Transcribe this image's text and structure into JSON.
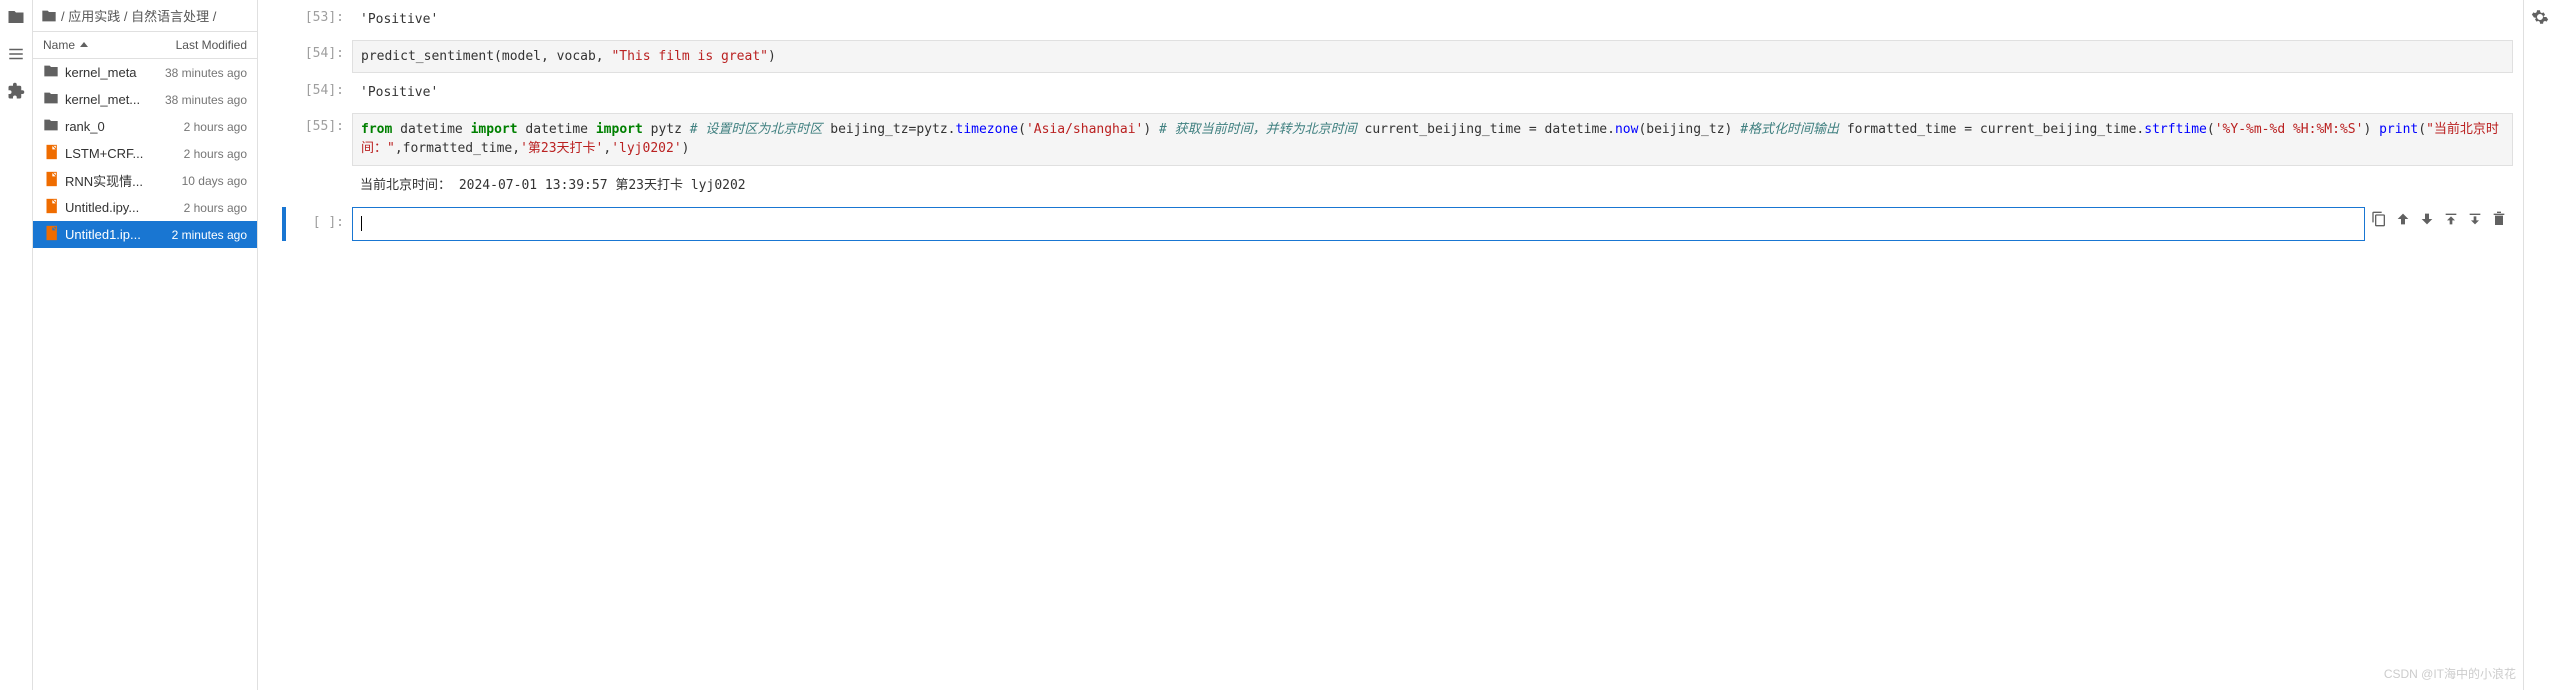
{
  "breadcrumb": {
    "parts": [
      "/",
      "应用实践",
      "/",
      "自然语言处理",
      "/"
    ]
  },
  "file_header": {
    "name": "Name",
    "modified": "Last Modified"
  },
  "files": [
    {
      "name": "kernel_meta",
      "time": "38 minutes ago",
      "type": "folder"
    },
    {
      "name": "kernel_met...",
      "time": "38 minutes ago",
      "type": "folder"
    },
    {
      "name": "rank_0",
      "time": "2 hours ago",
      "type": "folder"
    },
    {
      "name": "LSTM+CRF...",
      "time": "2 hours ago",
      "type": "notebook"
    },
    {
      "name": "RNN实现情...",
      "time": "10 days ago",
      "type": "notebook"
    },
    {
      "name": "Untitled.ipy...",
      "time": "2 hours ago",
      "type": "notebook"
    },
    {
      "name": "Untitled1.ip...",
      "time": "2 minutes ago",
      "type": "notebook",
      "selected": true
    }
  ],
  "cells": {
    "out53_prompt": "[53]:",
    "out53_text": "'Positive'",
    "in54_prompt": "[54]:",
    "in54_code": {
      "pre": "predict_sentiment(model, vocab, ",
      "str": "\"This film is great\"",
      "post": ")"
    },
    "out54_prompt": "[54]:",
    "out54_text": "'Positive'",
    "in55_prompt": "[55]:",
    "in55": {
      "l1_kw1": "from",
      "l1_t1": " datetime ",
      "l1_kw2": "import",
      "l1_t2": " datetime",
      "l2_kw1": "import",
      "l2_t1": " pytz",
      "l3_cmt": "# 设置时区为北京时区",
      "l4_t1": "beijing_tz=pytz.",
      "l4_fn": "timezone",
      "l4_t2": "(",
      "l4_str": "'Asia/shanghai'",
      "l4_t3": ")",
      "l5_cmt": "# 获取当前时间，并转为北京时间",
      "l6_t1": "current_beijing_time = datetime.",
      "l6_fn": "now",
      "l6_t2": "(beijing_tz)",
      "l7_cmt": "#格式化时间输出",
      "l8_t1": "formatted_time = current_beijing_time.",
      "l8_fn": "strftime",
      "l8_t2": "(",
      "l8_str": "'%Y-%m-%d %H:%M:%S'",
      "l8_t3": ")",
      "l9_fn": "print",
      "l9_t1": "(",
      "l9_str1": "\"当前北京时间：\"",
      "l9_t2": ",formatted_time,",
      "l9_str2": "'第23天打卡'",
      "l9_t3": ",",
      "l9_str3": "'lyj0202'",
      "l9_t4": ")"
    },
    "out55_text": "当前北京时间： 2024-07-01 13:39:57 第23天打卡 lyj0202",
    "empty_prompt": "[ ]:"
  },
  "watermark": "CSDN @IT海中的小浪花"
}
